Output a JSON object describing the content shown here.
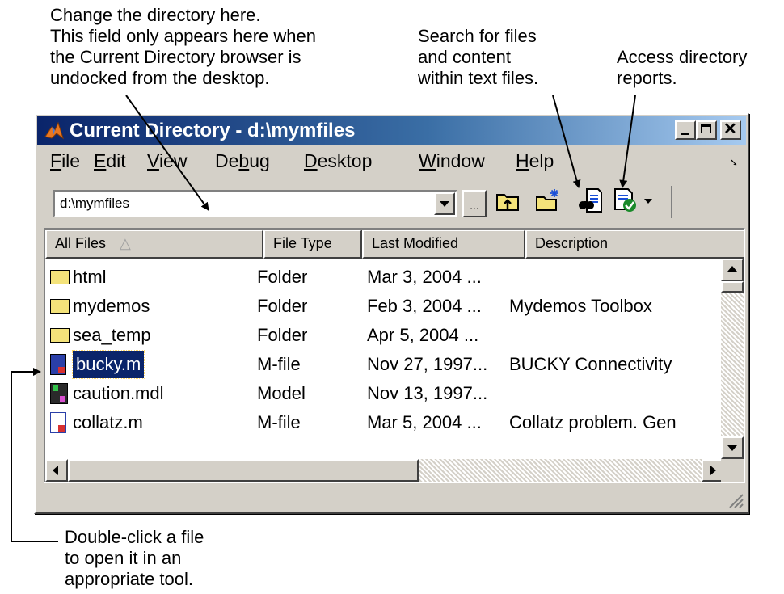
{
  "callouts": {
    "change_dir": "Change the directory here.\nThis field only appears here when\nthe Current Directory browser is\nundocked from the desktop.",
    "search": "Search for files\nand content\nwithin text files.",
    "reports": "Access directory\nreports.",
    "double_click": "Double-click a file\nto open it in an\nappropriate tool."
  },
  "window": {
    "title": "Current Directory - d:\\mymfiles",
    "controls": [
      "minimize-icon",
      "maximize-icon",
      "close-icon"
    ]
  },
  "menu": {
    "items": [
      {
        "accel": "F",
        "rest": "ile"
      },
      {
        "accel": "E",
        "rest": "dit"
      },
      {
        "accel": "V",
        "rest": "iew"
      },
      {
        "pre": "De",
        "accel": "b",
        "rest": "ug"
      },
      {
        "accel": "D",
        "rest": "esktop"
      },
      {
        "accel": "W",
        "rest": "indow"
      },
      {
        "accel": "H",
        "rest": "elp"
      }
    ]
  },
  "toolbar": {
    "path_value": "d:\\mymfiles",
    "browse_label": "...",
    "icons": [
      "up-folder-icon",
      "new-folder-icon",
      "find-files-icon",
      "directory-reports-icon",
      "reports-dropdown-icon"
    ]
  },
  "table": {
    "headers": [
      "All Files",
      "File Type",
      "Last Modified",
      "Description"
    ],
    "sort_indicator": "△",
    "rows": [
      {
        "icon": "folder-icon",
        "name": "html",
        "type": "Folder",
        "modified": "Mar 3, 2004 ...",
        "description": ""
      },
      {
        "icon": "folder-icon",
        "name": "mydemos",
        "type": "Folder",
        "modified": "Feb 3, 2004 ...",
        "description": "Mydemos Toolbox"
      },
      {
        "icon": "folder-icon",
        "name": "sea_temp",
        "type": "Folder",
        "modified": "Apr 5, 2004 ...",
        "description": ""
      },
      {
        "icon": "m-file-icon",
        "name": "bucky.m",
        "type": "M-file",
        "modified": "Nov 27, 1997...",
        "description": "BUCKY  Connectivity",
        "selected": true
      },
      {
        "icon": "model-file-icon",
        "name": "caution.mdl",
        "type": "Model",
        "modified": "Nov 13, 1997...",
        "description": ""
      },
      {
        "icon": "m-file-icon",
        "name": "collatz.m",
        "type": "M-file",
        "modified": "Mar 5, 2004 ...",
        "description": "Collatz problem. Gen"
      }
    ]
  },
  "colors": {
    "title_start": "#0a246a",
    "title_end": "#a6caf0",
    "selection": "#0a246a",
    "face": "#d4d0c8"
  }
}
